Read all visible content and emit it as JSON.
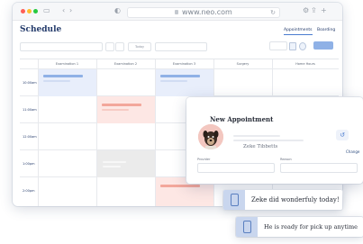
{
  "browser": {
    "url": "www.neo.com",
    "icons": [
      "back-icon",
      "forward-icon",
      "sidebar-icon",
      "shield-icon",
      "reload-icon",
      "settings-icon",
      "share-icon",
      "add-tab-icon"
    ]
  },
  "page": {
    "title": "Schedule",
    "tabs": [
      {
        "label": "Appointments",
        "active": true
      },
      {
        "label": "Boarding",
        "active": false
      }
    ],
    "toolbar": {
      "today_label": "Today"
    }
  },
  "grid": {
    "columns": [
      "Examination 1",
      "Examination 2",
      "Examination 3",
      "Surgery",
      "Home Hours"
    ],
    "times": [
      "10:00am",
      "11:00am",
      "12:00am",
      "1:00pm",
      "2:00pm"
    ]
  },
  "appointment": {
    "title": "New Appointment",
    "pet_name": "Zeke Tibbetts",
    "change_label": "Change",
    "fields": [
      {
        "label": "Provider"
      },
      {
        "label": "Reason"
      }
    ]
  },
  "notifications": [
    {
      "text": "Zeke did wonderfuly today!"
    },
    {
      "text": "He is ready for pick up anytime"
    }
  ],
  "colors": {
    "accent": "#4a7bd0",
    "title": "#243b6b",
    "event_blue": "#e8eefb",
    "event_red": "#fde7e4",
    "event_grey": "#ebebeb"
  }
}
